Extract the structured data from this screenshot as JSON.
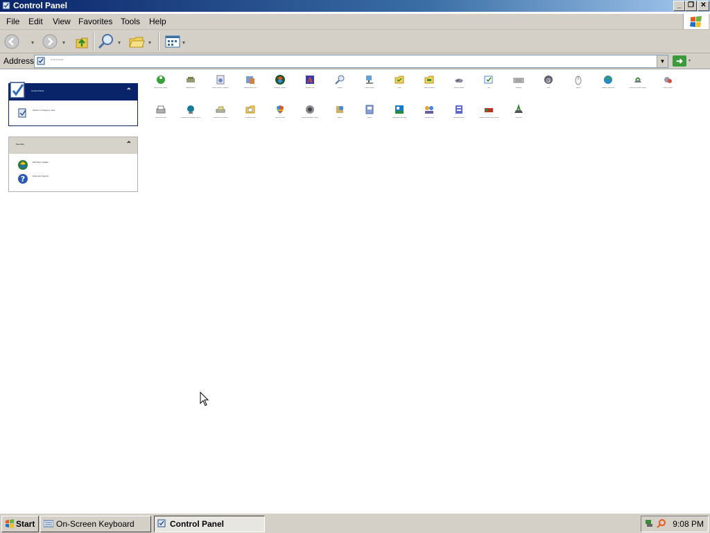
{
  "window": {
    "title": "Control Panel"
  },
  "titlebar": {
    "minimize": "_",
    "restore": "❐",
    "close": "✕"
  },
  "menubar": {
    "items": [
      "File",
      "Edit",
      "View",
      "Favorites",
      "Tools",
      "Help"
    ]
  },
  "address": {
    "label": "Address",
    "value": "Control Panel"
  },
  "sidebar": {
    "panel1": {
      "title": "Control Panel",
      "link": "Switch to Category View"
    },
    "panel2": {
      "title": "See Also",
      "links": [
        "Windows Update",
        "Help and Support"
      ]
    }
  },
  "icons": [
    "Accessibility Options",
    "Add Hardware",
    "Add or Remove Programs",
    "Administrative Tools",
    "Automatic Updates",
    "Date and Time",
    "Display",
    "Folder Options",
    "Fonts",
    "Game Controllers",
    "Internet Options",
    "Java",
    "Keyboard",
    "Mail",
    "Mouse",
    "Network Connections",
    "Phone and Modem Options",
    "Power Options",
    "Printers and Faxes",
    "Regional and Language Options",
    "Scanners and Cameras",
    "Scheduled Tasks",
    "Security Center",
    "Sounds and Audio Devices",
    "Speech",
    "System",
    "Taskbar and Start Menu",
    "User Accounts",
    "Windows Firewall",
    "Wireless Network Setup Wizard",
    "QuickTime",
    "Network Setup Wizard"
  ],
  "taskbar": {
    "start": "Start",
    "tasks": [
      "On-Screen Keyboard",
      "Control Panel"
    ],
    "clock": "9:08 PM"
  }
}
